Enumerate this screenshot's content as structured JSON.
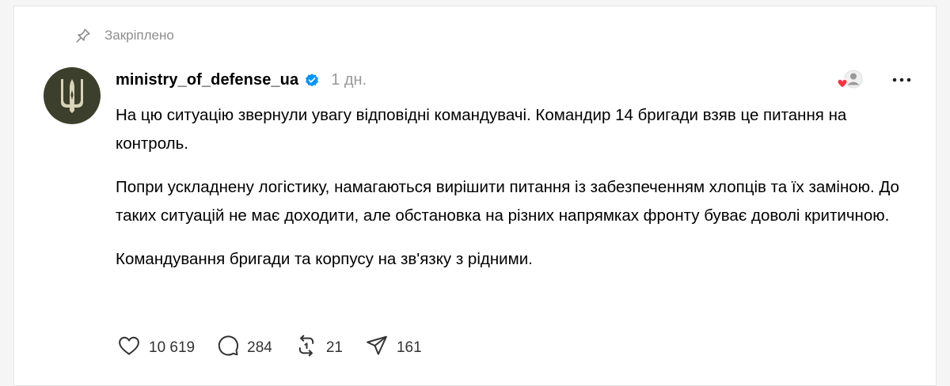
{
  "pinned": {
    "icon": "pin-icon",
    "label": "Закріплено"
  },
  "post": {
    "username": "ministry_of_defense_ua",
    "verified_icon": "verified-badge-icon",
    "time": "1 дн.",
    "paragraphs": [
      "На цю ситуацію звернули увагу відповідні командувачі. Командир 14 бригади взяв це питання на контроль.",
      "Попри ускладнену логістику, намагаються вирішити питання із забезпеченням хлопців та їх заміною. До таких ситуацій не має доходити, але обстановка на різних напрямках фронту буває доволі критичною.",
      "Командування бригади та корпусу на зв'язку з рідними."
    ],
    "actions": {
      "likes": "10 619",
      "replies": "284",
      "reposts": "21",
      "shares": "161"
    }
  },
  "colors": {
    "avatar_bg": "#3b3f2b",
    "verified": "#0095f6",
    "heart": "#ff3040",
    "muted": "#8e8e8e"
  }
}
